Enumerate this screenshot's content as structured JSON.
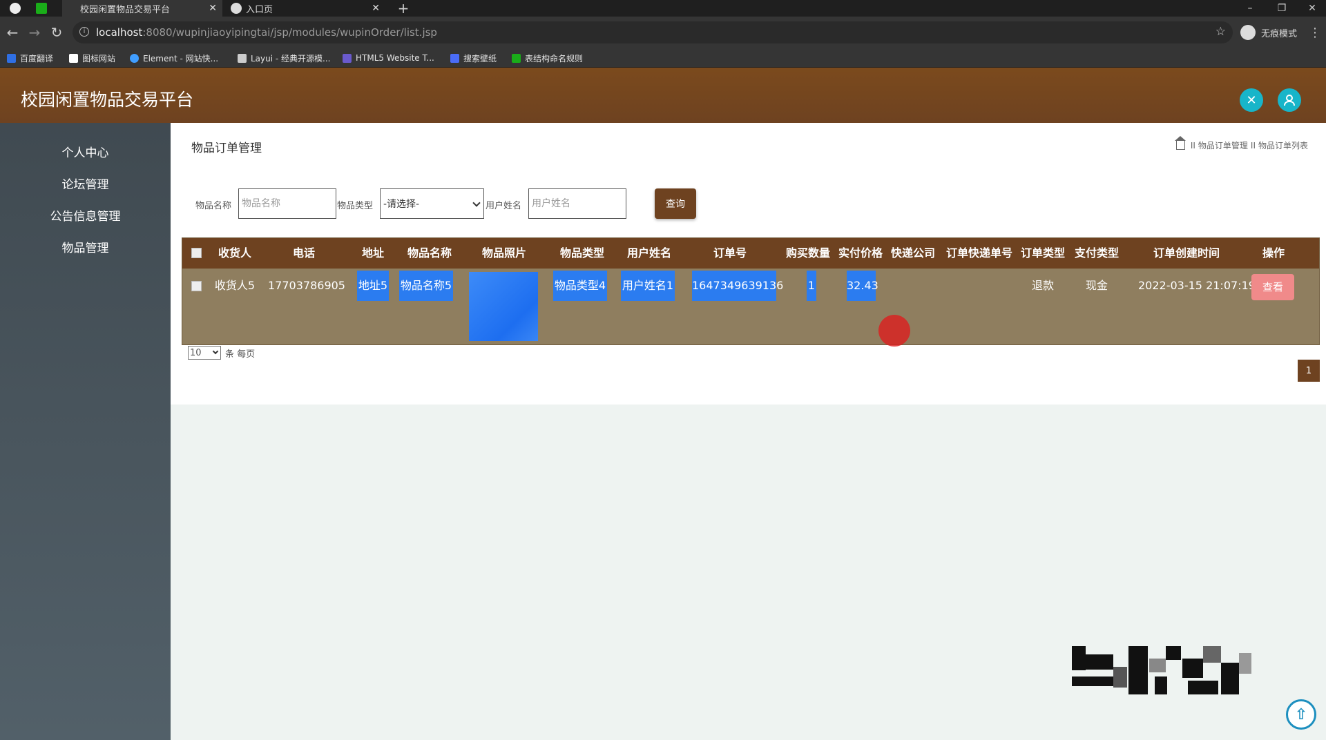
{
  "browser": {
    "tabs": [
      {
        "title": "校园闲置物品交易平台",
        "active": true
      },
      {
        "title": "入口页",
        "active": false
      }
    ],
    "url_host": "localhost",
    "url_path": ":8080/wupinjiaoyipingtai/jsp/modules/wupinOrder/list.jsp",
    "incognito_label": "无痕模式",
    "bookmarks": [
      {
        "label": "百度翻译",
        "color": "#2f6fe4"
      },
      {
        "label": "图标网站",
        "color": "#ffffff"
      },
      {
        "label": "Element - 网站快...",
        "color": "#409eff"
      },
      {
        "label": "Layui - 经典开源模...",
        "color": "#cccccc"
      },
      {
        "label": "HTML5 Website T...",
        "color": "#6a5acd"
      },
      {
        "label": "搜索壁纸",
        "color": "#4a6cf7"
      },
      {
        "label": "表结构命名规则",
        "color": "#1aad19"
      }
    ]
  },
  "app": {
    "title": "校园闲置物品交易平台",
    "accent": "#6e4220"
  },
  "sidebar": {
    "items": [
      {
        "label": "个人中心"
      },
      {
        "label": "论坛管理"
      },
      {
        "label": "公告信息管理"
      },
      {
        "label": "物品管理"
      }
    ]
  },
  "page": {
    "title": "物品订单管理",
    "breadcrumb": [
      "物品订单管理",
      "物品订单列表"
    ],
    "breadcrumb_sep": "II"
  },
  "search": {
    "name_label": "物品名称",
    "name_placeholder": "物品名称",
    "type_label": "物品类型",
    "type_selected": "-请选择-",
    "user_label": "用户姓名",
    "user_placeholder": "用户姓名",
    "query_label": "查询"
  },
  "table": {
    "headers": [
      "收货人",
      "电话",
      "地址",
      "物品名称",
      "物品照片",
      "物品类型",
      "用户姓名",
      "订单号",
      "购买数量",
      "实付价格",
      "快递公司",
      "订单快递单号",
      "订单类型",
      "支付类型",
      "订单创建时间",
      "操作"
    ],
    "rows": [
      {
        "receiver": "收货人5",
        "phone": "17703786905",
        "address": "地址5",
        "item_name": "物品名称5",
        "item_type": "物品类型4",
        "user_name": "用户姓名1",
        "order_no": "1647349639136",
        "quantity": "1",
        "price": "32.43",
        "courier": "",
        "tracking_no": "",
        "order_type": "退款",
        "pay_type": "现金",
        "created_at": "2022-03-15 21:07:19",
        "action": "查看"
      }
    ]
  },
  "pager": {
    "page_size": "10",
    "page_size_suffix": "条 每页",
    "current_page": "1"
  }
}
